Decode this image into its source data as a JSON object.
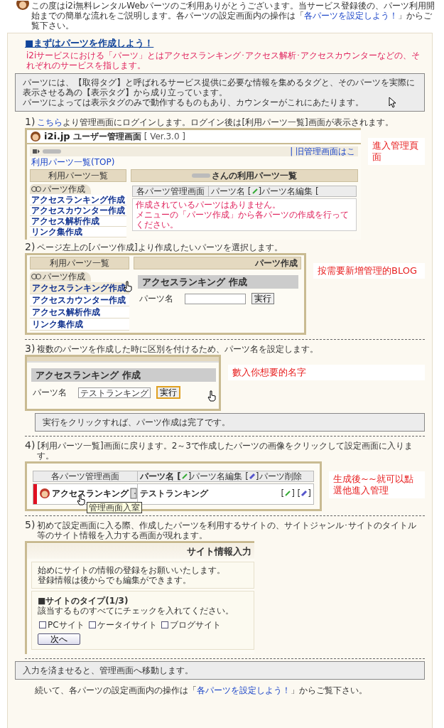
{
  "intro": {
    "before": "この度はi2i無料レンタルWebパーツのご利用ありがとうございます。当サービス登録後の、パーツ利用開始までの簡単な流れをご説明します。各パーツの設定画面内の操作は「",
    "link": "各パーツを設定しよう！",
    "after": "」からご覧下さい。"
  },
  "section": {
    "title": "■まずはパーツを作成しよう！",
    "lead": "i2iサービスにおける「パーツ」とはアクセスランキング･アクセス解析･アクセスカウンターなどの、それぞれのサービスを指します。",
    "note": [
      "パーツには、【取得タグ】と呼ばれるサービス提供に必要な情報を集めるタグと、そのパーツを実際に表示させる為の【表示タグ】から成り立っています。",
      "パーツによっては表示タグのみで動作するものもあり、カウンターがこれにあたります。"
    ]
  },
  "steps": [
    {
      "kind": "login",
      "number": "1)",
      "link": "こちら",
      "text": "より管理画面にログインします。ログイン後は[利用パーツ一覧]画面が表示されます。",
      "annotation": "進入管理頁面",
      "screen": {
        "logo": "i2i.jp",
        "app_title": "ユーザー管理画面",
        "version": "[ Ver.3.0 ]",
        "old_link": "| 旧管理画面はこ",
        "breadcrumb": "利用パーツ一覧(TOP)",
        "menu_title": "利用パーツ一覧",
        "menu_tab": "パーツ作成",
        "menu": [
          {
            "label": "アクセスランキング作成"
          },
          {
            "label": "アクセスカウンター作成"
          },
          {
            "label": "アクセス解析作成"
          },
          {
            "label": "リンク集作成"
          }
        ],
        "list_title": "さんの利用パーツ一覧",
        "columns": [
          "各パーツ管理画面",
          "パーツ名 [",
          "]パーツ名編集 ["
        ],
        "messages": [
          "作成されているパーツはありません。",
          "メニューの「パーツ作成」から各パーツの作成を行ってください。"
        ]
      }
    },
    {
      "kind": "create",
      "number": "2)",
      "text": "ページ左上の[パーツ作成]より作成したいパーツを選択します。",
      "annotation": "按需要新增管理的BLOG",
      "screen": {
        "menu_title": "利用パーツ一覧",
        "menu_tab": "パーツ作成",
        "menu": [
          {
            "label": "アクセスランキング作成",
            "highlighted": true
          },
          {
            "label": "アクセスカウンター作成",
            "highlighted": false
          },
          {
            "label": "アクセス解析作成",
            "highlighted": false
          },
          {
            "label": "リンク集作成",
            "highlighted": false
          }
        ],
        "panel_title": "パーツ作成",
        "form_title": "アクセスランキング 作成",
        "field_label": "パーツ名",
        "button": "実行"
      }
    },
    {
      "kind": "name",
      "number": "3)",
      "text": "複数のパーツを作成した時に区別を付けるため、パーツ名を設定します。",
      "annotation": "數入你想要的名字",
      "screen": {
        "form_title": "アクセスランキング 作成",
        "field_label": "パーツ名",
        "value": "テストランキング",
        "button": "実行"
      },
      "note": "実行をクリックすれば、パーツ作成は完了です。"
    },
    {
      "kind": "list",
      "number": "4)",
      "text": "[利用パーツ一覧]画面に戻ります。2～3で作成したパーツの画像をクリックして設定画面に入ります。",
      "annotation": "生成後~~就可以點選他進入管理",
      "screen": {
        "columns": [
          "各パーツ管理画面",
          "パーツ名 [",
          "]パーツ名編集 [",
          "]パーツ削除"
        ],
        "service": "アクセスランキング",
        "part_name": "テストランキング",
        "actions": [
          "[",
          "] [",
          "]"
        ],
        "tooltip": "管理画面入室"
      }
    },
    {
      "kind": "site",
      "number": "5)",
      "text": "初めて設定画面に入る際、作成したパーツを利用するサイトの、サイトジャンル･サイトのタイトル等のサイト情報を入力する画面が現れます。",
      "screen": {
        "title": "サイト情報入力",
        "intro": [
          "始めにサイトの情報の登録をお願いいたします。",
          "登録情報は後からでも編集ができます。"
        ],
        "heading": "■サイトのタイプ(1/3)",
        "instruction": "該当するものすべてにチェックを入れてください。",
        "options": [
          {
            "label": "PCサイト",
            "checked": false
          },
          {
            "label": "ケータイサイト",
            "checked": false
          },
          {
            "label": "ブログサイト",
            "checked": false
          }
        ],
        "button": "次へ"
      }
    }
  ],
  "closing": {
    "note": "入力を済ませると、管理画面へ移動します。",
    "footer_before": "続いて、各パーツの設定画面内の操作は「",
    "footer_link": "各パーツを設定しよう！",
    "footer_after": "」からご覧下さい。"
  }
}
